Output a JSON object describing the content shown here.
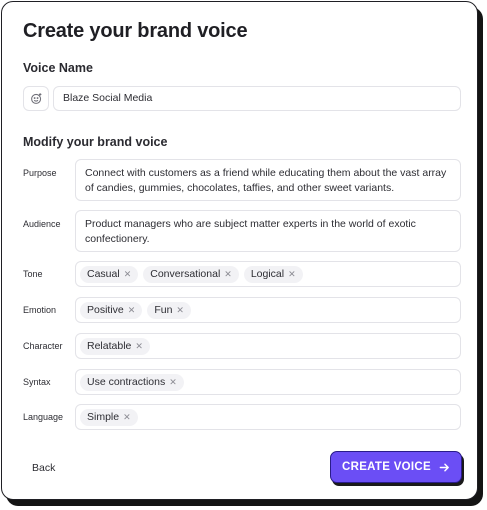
{
  "header": {
    "title": "Create your brand voice"
  },
  "voice_name": {
    "label": "Voice Name",
    "value": "Blaze Social Media",
    "icon": "emoji-add-icon"
  },
  "modify": {
    "heading": "Modify your brand voice",
    "purpose": {
      "label": "Purpose",
      "value": "Connect with customers as a friend while educating them about the vast array of candies, gummies, chocolates, taffies, and other sweet variants."
    },
    "audience": {
      "label": "Audience",
      "value": "Product managers who are subject matter experts in the world of exotic confectionery."
    },
    "tone": {
      "label": "Tone",
      "chips": [
        "Casual",
        "Conversational",
        "Logical"
      ]
    },
    "emotion": {
      "label": "Emotion",
      "chips": [
        "Positive",
        "Fun"
      ]
    },
    "character": {
      "label": "Character",
      "chips": [
        "Relatable"
      ]
    },
    "syntax": {
      "label": "Syntax",
      "chips": [
        "Use contractions"
      ]
    },
    "language": {
      "label": "Language",
      "chips": [
        "Simple"
      ]
    }
  },
  "footer": {
    "back_label": "Back",
    "create_label": "CREATE VOICE",
    "create_icon": "arrow-right-icon"
  },
  "colors": {
    "accent": "#6b4ef5",
    "border": "#e3e3e8",
    "chip_bg": "#f2f2f5"
  }
}
